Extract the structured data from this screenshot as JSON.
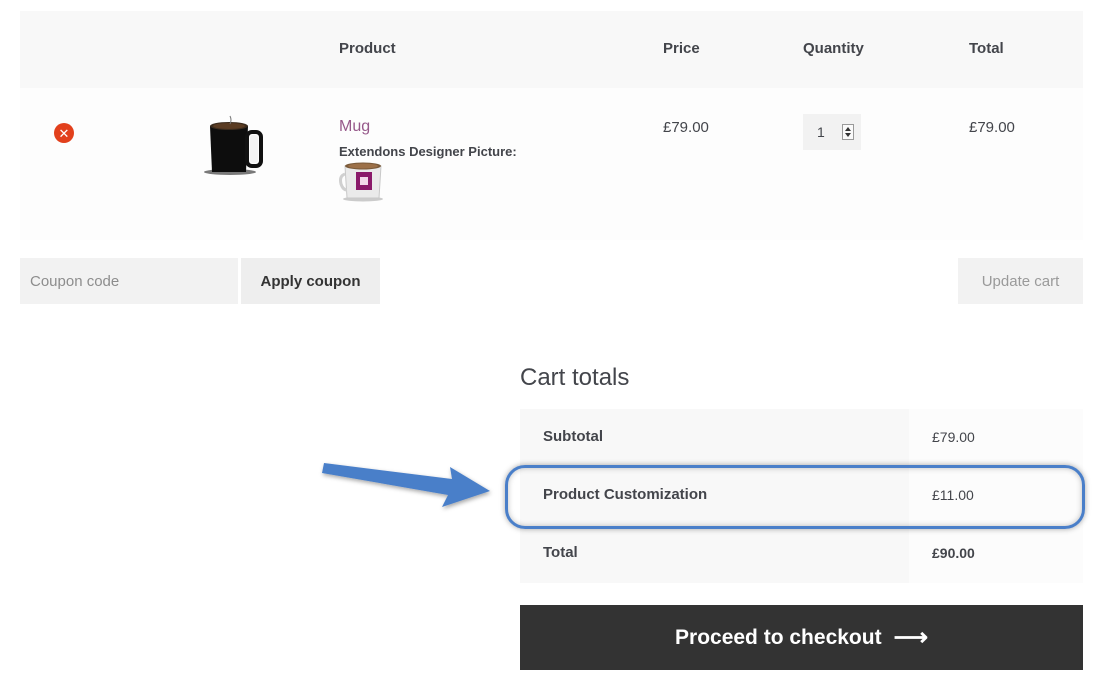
{
  "cart_table": {
    "headers": {
      "product": "Product",
      "price": "Price",
      "quantity": "Quantity",
      "total": "Total"
    },
    "items": [
      {
        "name": "Mug",
        "meta_label": "Extendons Designer Picture:",
        "price": "£79.00",
        "quantity": "1",
        "total": "£79.00",
        "remove_icon": "remove-circle-icon"
      }
    ]
  },
  "coupon": {
    "placeholder": "Coupon code",
    "value": "",
    "apply_label": "Apply coupon"
  },
  "update_cart_label": "Update cart",
  "cart_totals": {
    "title": "Cart totals",
    "rows": [
      {
        "label": "Subtotal",
        "value": "£79.00"
      },
      {
        "label": "Product Customization",
        "value": "£11.00"
      },
      {
        "label": "Total",
        "value": "£90.00"
      }
    ]
  },
  "checkout": {
    "label": "Proceed to checkout",
    "arrow": "⟶"
  },
  "colors": {
    "accent_link": "#96588a",
    "remove_red": "#e2401c",
    "highlight_blue": "#4a7fc9",
    "checkout_bg": "#333333"
  }
}
